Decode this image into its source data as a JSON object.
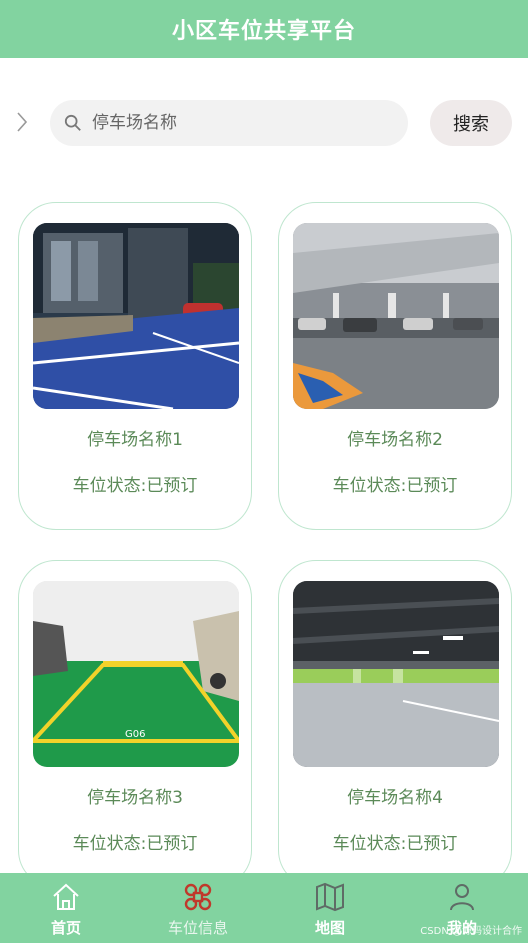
{
  "header": {
    "title": "小区车位共享平台"
  },
  "search": {
    "placeholder": "停车场名称",
    "button_label": "搜索"
  },
  "cards": [
    {
      "name": "停车场名称1",
      "status": "车位状态:已预订"
    },
    {
      "name": "停车场名称2",
      "status": "车位状态:已预订"
    },
    {
      "name": "停车场名称3",
      "status": "车位状态:已预订"
    },
    {
      "name": "停车场名称4",
      "status": "车位状态:已预订"
    }
  ],
  "tabbar": {
    "items": [
      {
        "label": "首页",
        "icon": "home-icon"
      },
      {
        "label": "车位信息",
        "icon": "command-icon"
      },
      {
        "label": "地图",
        "icon": "map-icon"
      },
      {
        "label": "我的",
        "icon": "user-icon"
      }
    ]
  },
  "watermark": "CSDN @源码设计合作",
  "colors": {
    "accent": "#82d3a0",
    "card_text": "#5b8a58",
    "card_border": "#bfe6cf"
  }
}
